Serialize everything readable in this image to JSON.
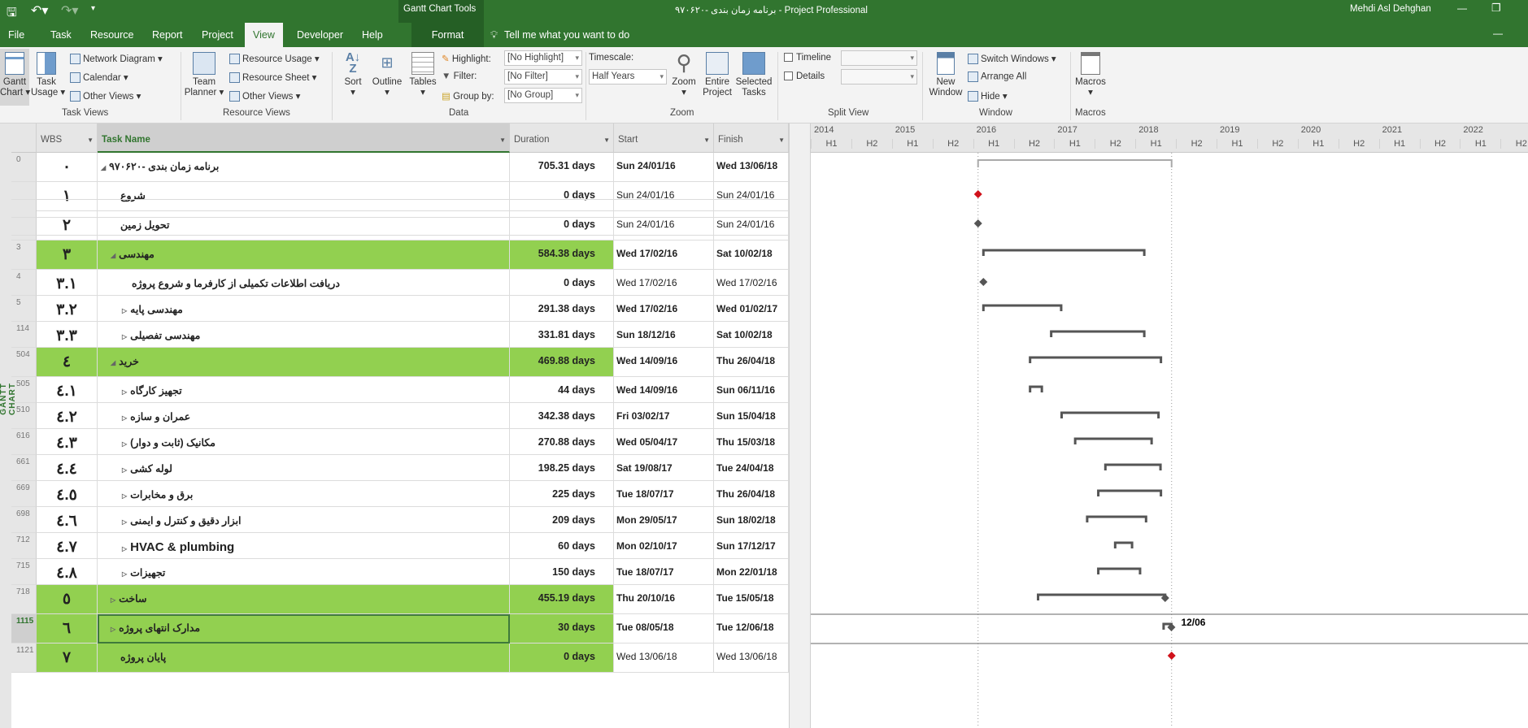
{
  "titlebar": {
    "context_tools": "Gantt Chart Tools",
    "title": "برنامه زمان بندی -۹۷۰۶۲۰  -  Project Professional",
    "user": "Mehdi Asl Dehghan",
    "minimize": "—",
    "restore": "❐",
    "ribbon_collapse": "—"
  },
  "tabs": [
    {
      "label": "File"
    },
    {
      "label": "Task"
    },
    {
      "label": "Resource"
    },
    {
      "label": "Report"
    },
    {
      "label": "Project"
    },
    {
      "label": "View",
      "active": true
    },
    {
      "label": "Developer"
    },
    {
      "label": "Help"
    },
    {
      "label": "Format"
    }
  ],
  "tell_me": "Tell me what you want to do",
  "ribbon": {
    "task_views": {
      "label": "Task Views",
      "gantt_l1": "Gantt",
      "gantt_l2": "Chart ▾",
      "usage_l1": "Task",
      "usage_l2": "Usage ▾",
      "network": "Network Diagram ▾",
      "calendar": "Calendar ▾",
      "other": "Other Views ▾"
    },
    "resource_views": {
      "label": "Resource Views",
      "team_l1": "Team",
      "team_l2": "Planner ▾",
      "usage": "Resource Usage ▾",
      "sheet": "Resource Sheet ▾",
      "other": "Other Views ▾"
    },
    "data": {
      "label": "Data",
      "sort": "Sort",
      "outline": "Outline",
      "tables": "Tables",
      "highlight": "Highlight:",
      "highlight_value": "[No Highlight]",
      "filter": "Filter:",
      "filter_value": "[No Filter]",
      "group": "Group by:",
      "group_value": "[No Group]"
    },
    "zoom": {
      "label": "Zoom",
      "timescale": "Timescale:",
      "timescale_value": "Half Years",
      "zoom": "Zoom",
      "entire_l1": "Entire",
      "entire_l2": "Project",
      "selected_l1": "Selected",
      "selected_l2": "Tasks"
    },
    "split": {
      "label": "Split View",
      "timeline": "Timeline",
      "details": "Details"
    },
    "window": {
      "label": "Window",
      "new_l1": "New",
      "new_l2": "Window",
      "switch": "Switch Windows ▾",
      "arrange": "Arrange All",
      "hide": "Hide ▾"
    },
    "macros": {
      "label": "Macros",
      "macros": "Macros"
    }
  },
  "side_label": "GANTT CHART",
  "columns": {
    "wbs": "WBS",
    "name": "Task Name",
    "duration": "Duration",
    "start": "Start",
    "finish": "Finish"
  },
  "timescale": {
    "years": [
      "2014",
      "2015",
      "2016",
      "2017",
      "2018",
      "2019",
      "2020",
      "2021",
      "2022"
    ],
    "halves": [
      "H1",
      "H2"
    ],
    "start_year": 2014
  },
  "colors": {
    "summary_row": "#92d050",
    "milestone_critical": "#d0121b",
    "bar": "#555555",
    "brand": "#31752f"
  },
  "rows": [
    {
      "id": "0",
      "wbs": "٠",
      "name": "برنامه زمان بندی -۹۷۰۶۲۰",
      "level": 0,
      "toggle": "expanded",
      "duration": "705.31 days",
      "start": "Sun 24/01/16",
      "finish": "Wed 13/06/18",
      "dates_bold": true,
      "green": false,
      "bar": "project"
    },
    {
      "id": "1",
      "wbs": "١",
      "name": "شروع",
      "level": 1,
      "toggle": "",
      "duration": "0 days",
      "start": "Sun 24/01/16",
      "finish": "Sun 24/01/16",
      "dates_bold": false,
      "green": false,
      "bar": "milestone-critical"
    },
    {
      "id": "2",
      "wbs": "٢",
      "name": "تحویل زمین",
      "level": 1,
      "toggle": "",
      "duration": "0 days",
      "start": "Sun 24/01/16",
      "finish": "Sun 24/01/16",
      "dates_bold": false,
      "green": false,
      "bar": "milestone"
    },
    {
      "id": "3",
      "wbs": "٣",
      "name": "مهندسی",
      "level": 1,
      "toggle": "expanded",
      "duration": "584.38 days",
      "start": "Wed 17/02/16",
      "finish": "Sat 10/02/18",
      "dates_bold": true,
      "green": true,
      "bar": "summary"
    },
    {
      "id": "4",
      "wbs": "٣.١",
      "name": "دریافت اطلاعات تکمیلی از کارفرما و شروع پروژه",
      "level": 2,
      "toggle": "",
      "duration": "0 days",
      "start": "Wed 17/02/16",
      "finish": "Wed 17/02/16",
      "dates_bold": false,
      "green": false,
      "bar": "milestone"
    },
    {
      "id": "5",
      "wbs": "٣.٢",
      "name": "مهندسی پایه",
      "level": 2,
      "toggle": "collapsed",
      "duration": "291.38 days",
      "start": "Wed 17/02/16",
      "finish": "Wed 01/02/17",
      "dates_bold": true,
      "green": false,
      "bar": "summary"
    },
    {
      "id": "114",
      "wbs": "٣.٣",
      "name": "مهندسی تفصیلی",
      "level": 2,
      "toggle": "collapsed",
      "duration": "331.81 days",
      "start": "Sun 18/12/16",
      "finish": "Sat 10/02/18",
      "dates_bold": true,
      "green": false,
      "bar": "summary"
    },
    {
      "id": "504",
      "wbs": "٤",
      "name": "خرید",
      "level": 1,
      "toggle": "expanded",
      "duration": "469.88 days",
      "start": "Wed 14/09/16",
      "finish": "Thu 26/04/18",
      "dates_bold": true,
      "green": true,
      "bar": "summary"
    },
    {
      "id": "505",
      "wbs": "٤.١",
      "name": "تجهیز کارگاه",
      "level": 2,
      "toggle": "collapsed",
      "duration": "44 days",
      "start": "Wed 14/09/16",
      "finish": "Sun 06/11/16",
      "dates_bold": true,
      "green": false,
      "bar": "summary"
    },
    {
      "id": "510",
      "wbs": "٤.٢",
      "name": "عمران و سازه",
      "level": 2,
      "toggle": "collapsed",
      "duration": "342.38 days",
      "start": "Fri 03/02/17",
      "finish": "Sun 15/04/18",
      "dates_bold": true,
      "green": false,
      "bar": "summary"
    },
    {
      "id": "616",
      "wbs": "٤.٣",
      "name": "مکانیک (ثابت و دوار)",
      "level": 2,
      "toggle": "collapsed",
      "duration": "270.88 days",
      "start": "Wed 05/04/17",
      "finish": "Thu 15/03/18",
      "dates_bold": true,
      "green": false,
      "bar": "summary"
    },
    {
      "id": "661",
      "wbs": "٤.٤",
      "name": "لوله کشی",
      "level": 2,
      "toggle": "collapsed",
      "duration": "198.25 days",
      "start": "Sat 19/08/17",
      "finish": "Tue 24/04/18",
      "dates_bold": true,
      "green": false,
      "bar": "summary"
    },
    {
      "id": "669",
      "wbs": "٤.٥",
      "name": "برق و مخابرات",
      "level": 2,
      "toggle": "collapsed",
      "duration": "225 days",
      "start": "Tue 18/07/17",
      "finish": "Thu 26/04/18",
      "dates_bold": true,
      "green": false,
      "bar": "summary"
    },
    {
      "id": "698",
      "wbs": "٤.٦",
      "name": "ابزار دقیق و کنترل و ایمنی",
      "level": 2,
      "toggle": "collapsed",
      "duration": "209 days",
      "start": "Mon 29/05/17",
      "finish": "Sun 18/02/18",
      "dates_bold": true,
      "green": false,
      "bar": "summary"
    },
    {
      "id": "712",
      "wbs": "٤.٧",
      "name": "HVAC & plumbing",
      "level": 2,
      "toggle": "collapsed",
      "duration": "60 days",
      "start": "Mon 02/10/17",
      "finish": "Sun 17/12/17",
      "dates_bold": true,
      "green": false,
      "bar": "summary"
    },
    {
      "id": "715",
      "wbs": "٤.٨",
      "name": "تجهیزات",
      "level": 2,
      "toggle": "collapsed",
      "duration": "150 days",
      "start": "Tue 18/07/17",
      "finish": "Mon 22/01/18",
      "dates_bold": true,
      "green": false,
      "bar": "summary"
    },
    {
      "id": "718",
      "wbs": "٥",
      "name": "ساخت",
      "level": 1,
      "toggle": "collapsed",
      "duration": "455.19 days",
      "start": "Thu 20/10/16",
      "finish": "Tue 15/05/18",
      "dates_bold": true,
      "green": true,
      "bar": "summary-diamond"
    },
    {
      "id": "1115",
      "wbs": "٦",
      "name": "مدارک انتهای پروژه",
      "level": 1,
      "toggle": "collapsed",
      "duration": "30 days",
      "start": "Tue 08/05/18",
      "finish": "Tue 12/06/18",
      "dates_bold": true,
      "green": true,
      "selected": true,
      "bar": "summary-diamond",
      "bar_label": "12/06"
    },
    {
      "id": "1121",
      "wbs": "٧",
      "name": "پایان پروژه",
      "level": 1,
      "toggle": "",
      "duration": "0 days",
      "start": "Wed 13/06/18",
      "finish": "Wed 13/06/18",
      "dates_bold": false,
      "green": true,
      "bar": "milestone-critical"
    }
  ]
}
